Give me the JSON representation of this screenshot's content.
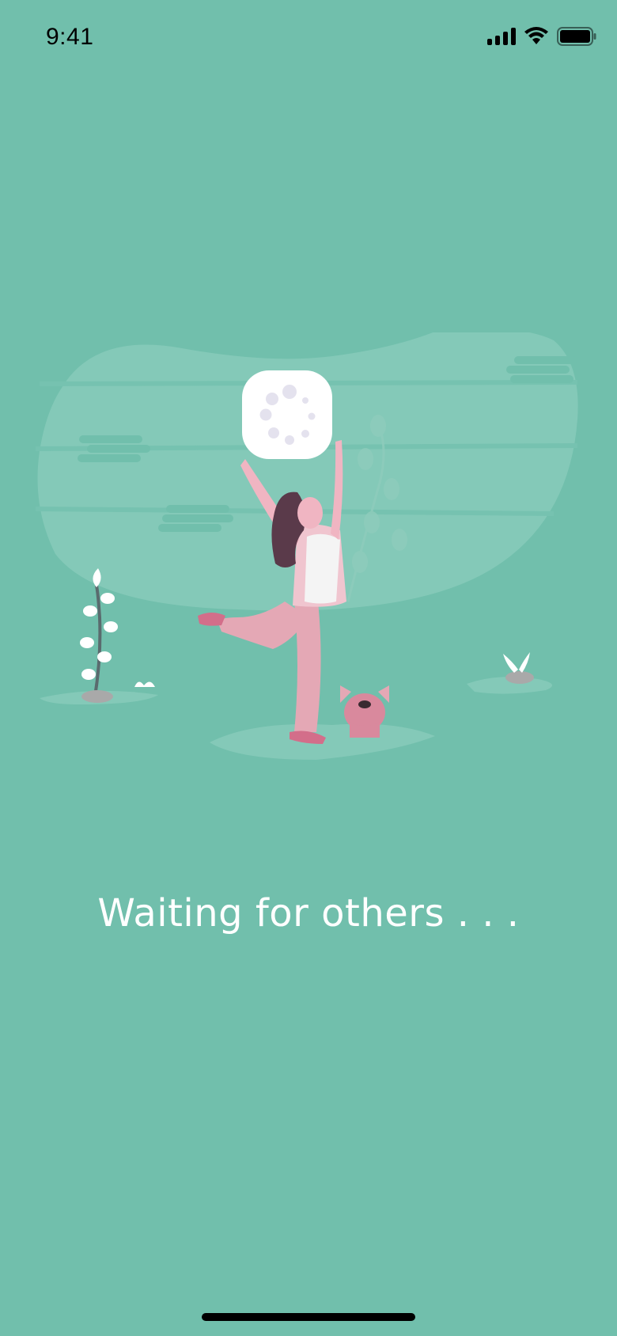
{
  "status_bar": {
    "time": "9:41",
    "icons": [
      "signal-icon",
      "wifi-icon",
      "battery-icon"
    ]
  },
  "illustration": {
    "elements": [
      "loading-spinner-icon",
      "dancing-woman",
      "dog",
      "plant",
      "rocks"
    ]
  },
  "message": {
    "text": "Waiting for others . . ."
  },
  "colors": {
    "background": "#71bfac",
    "blob": "#84c9b8",
    "text": "#ffffff",
    "accent": "#e4a8b5"
  }
}
